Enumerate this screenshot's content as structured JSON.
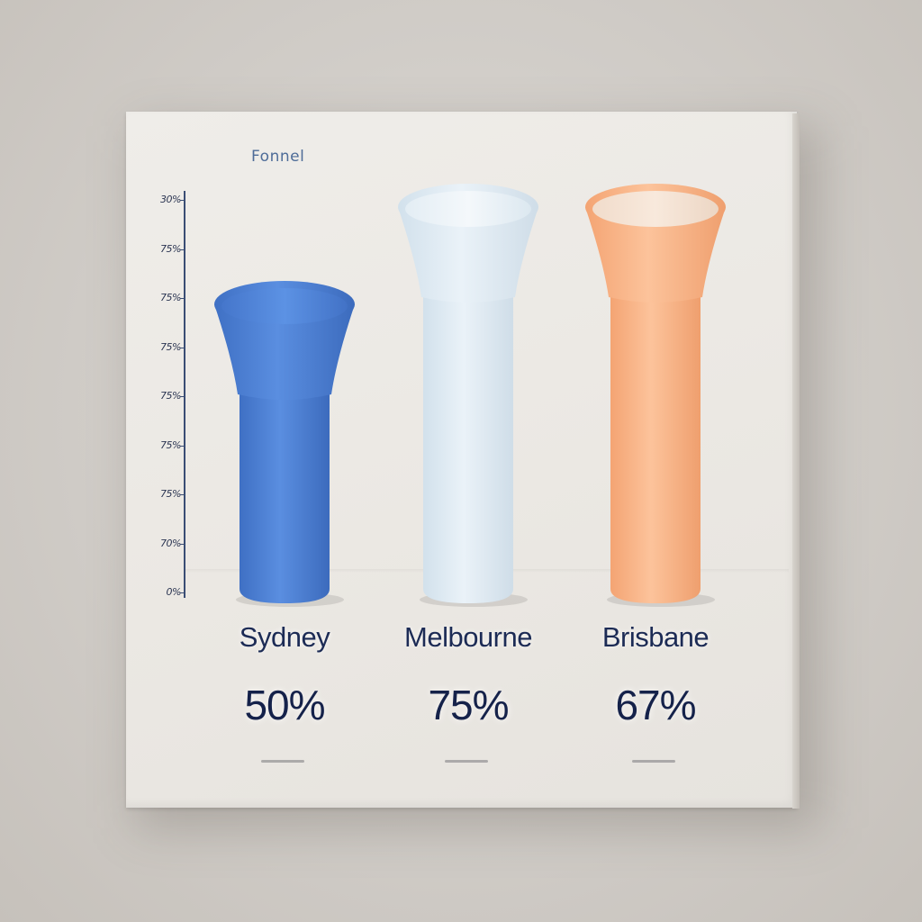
{
  "chart_data": {
    "type": "bar",
    "title": "Fonnel",
    "categories": [
      "Sydney",
      "Melbourne",
      "Brisbane"
    ],
    "values": [
      50,
      75,
      67
    ],
    "value_labels": [
      "50%",
      "75%",
      "67%"
    ],
    "y_tick_labels": [
      "30%",
      "75%",
      "75%",
      "75%",
      "75%",
      "75%",
      "75%",
      "70%",
      "0%"
    ],
    "colors": [
      "#4a7fd1",
      "#dde9f2",
      "#f9b487"
    ],
    "grid": false,
    "legend": "none"
  }
}
